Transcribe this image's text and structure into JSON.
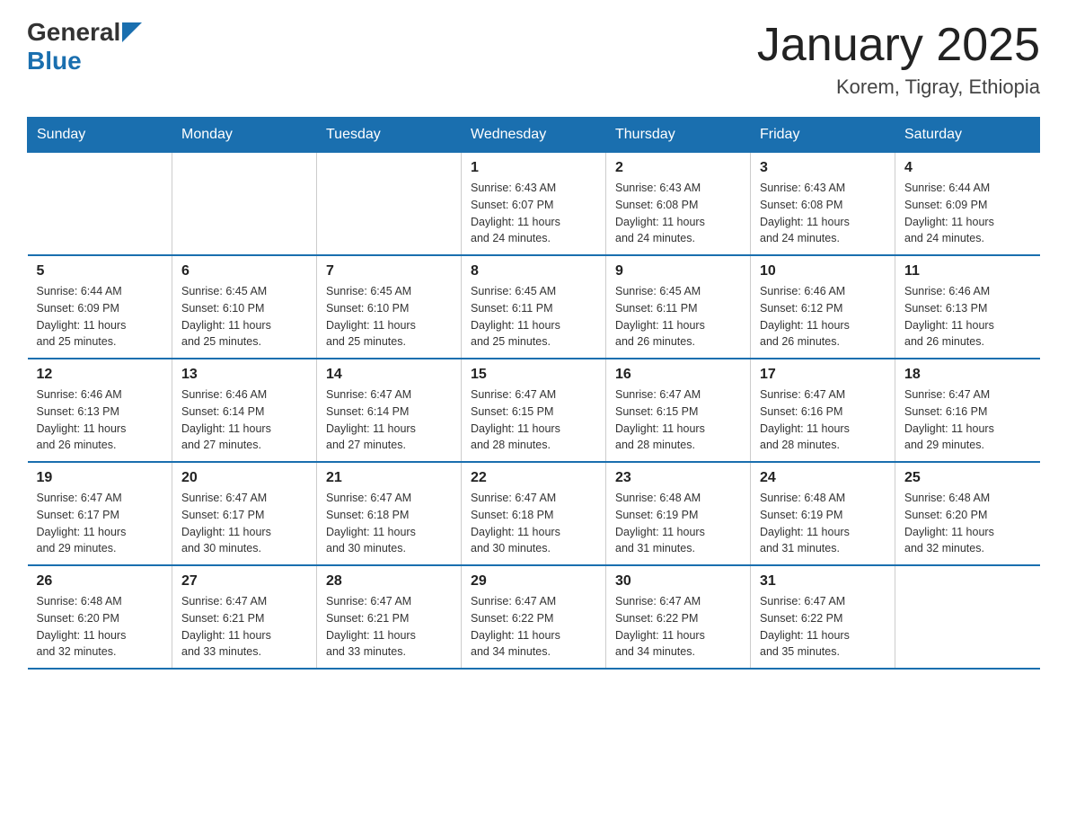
{
  "header": {
    "logo_general": "General",
    "logo_blue": "Blue",
    "title": "January 2025",
    "subtitle": "Korem, Tigray, Ethiopia"
  },
  "days_of_week": [
    "Sunday",
    "Monday",
    "Tuesday",
    "Wednesday",
    "Thursday",
    "Friday",
    "Saturday"
  ],
  "weeks": [
    [
      {
        "day": "",
        "info": ""
      },
      {
        "day": "",
        "info": ""
      },
      {
        "day": "",
        "info": ""
      },
      {
        "day": "1",
        "info": "Sunrise: 6:43 AM\nSunset: 6:07 PM\nDaylight: 11 hours\nand 24 minutes."
      },
      {
        "day": "2",
        "info": "Sunrise: 6:43 AM\nSunset: 6:08 PM\nDaylight: 11 hours\nand 24 minutes."
      },
      {
        "day": "3",
        "info": "Sunrise: 6:43 AM\nSunset: 6:08 PM\nDaylight: 11 hours\nand 24 minutes."
      },
      {
        "day": "4",
        "info": "Sunrise: 6:44 AM\nSunset: 6:09 PM\nDaylight: 11 hours\nand 24 minutes."
      }
    ],
    [
      {
        "day": "5",
        "info": "Sunrise: 6:44 AM\nSunset: 6:09 PM\nDaylight: 11 hours\nand 25 minutes."
      },
      {
        "day": "6",
        "info": "Sunrise: 6:45 AM\nSunset: 6:10 PM\nDaylight: 11 hours\nand 25 minutes."
      },
      {
        "day": "7",
        "info": "Sunrise: 6:45 AM\nSunset: 6:10 PM\nDaylight: 11 hours\nand 25 minutes."
      },
      {
        "day": "8",
        "info": "Sunrise: 6:45 AM\nSunset: 6:11 PM\nDaylight: 11 hours\nand 25 minutes."
      },
      {
        "day": "9",
        "info": "Sunrise: 6:45 AM\nSunset: 6:11 PM\nDaylight: 11 hours\nand 26 minutes."
      },
      {
        "day": "10",
        "info": "Sunrise: 6:46 AM\nSunset: 6:12 PM\nDaylight: 11 hours\nand 26 minutes."
      },
      {
        "day": "11",
        "info": "Sunrise: 6:46 AM\nSunset: 6:13 PM\nDaylight: 11 hours\nand 26 minutes."
      }
    ],
    [
      {
        "day": "12",
        "info": "Sunrise: 6:46 AM\nSunset: 6:13 PM\nDaylight: 11 hours\nand 26 minutes."
      },
      {
        "day": "13",
        "info": "Sunrise: 6:46 AM\nSunset: 6:14 PM\nDaylight: 11 hours\nand 27 minutes."
      },
      {
        "day": "14",
        "info": "Sunrise: 6:47 AM\nSunset: 6:14 PM\nDaylight: 11 hours\nand 27 minutes."
      },
      {
        "day": "15",
        "info": "Sunrise: 6:47 AM\nSunset: 6:15 PM\nDaylight: 11 hours\nand 28 minutes."
      },
      {
        "day": "16",
        "info": "Sunrise: 6:47 AM\nSunset: 6:15 PM\nDaylight: 11 hours\nand 28 minutes."
      },
      {
        "day": "17",
        "info": "Sunrise: 6:47 AM\nSunset: 6:16 PM\nDaylight: 11 hours\nand 28 minutes."
      },
      {
        "day": "18",
        "info": "Sunrise: 6:47 AM\nSunset: 6:16 PM\nDaylight: 11 hours\nand 29 minutes."
      }
    ],
    [
      {
        "day": "19",
        "info": "Sunrise: 6:47 AM\nSunset: 6:17 PM\nDaylight: 11 hours\nand 29 minutes."
      },
      {
        "day": "20",
        "info": "Sunrise: 6:47 AM\nSunset: 6:17 PM\nDaylight: 11 hours\nand 30 minutes."
      },
      {
        "day": "21",
        "info": "Sunrise: 6:47 AM\nSunset: 6:18 PM\nDaylight: 11 hours\nand 30 minutes."
      },
      {
        "day": "22",
        "info": "Sunrise: 6:47 AM\nSunset: 6:18 PM\nDaylight: 11 hours\nand 30 minutes."
      },
      {
        "day": "23",
        "info": "Sunrise: 6:48 AM\nSunset: 6:19 PM\nDaylight: 11 hours\nand 31 minutes."
      },
      {
        "day": "24",
        "info": "Sunrise: 6:48 AM\nSunset: 6:19 PM\nDaylight: 11 hours\nand 31 minutes."
      },
      {
        "day": "25",
        "info": "Sunrise: 6:48 AM\nSunset: 6:20 PM\nDaylight: 11 hours\nand 32 minutes."
      }
    ],
    [
      {
        "day": "26",
        "info": "Sunrise: 6:48 AM\nSunset: 6:20 PM\nDaylight: 11 hours\nand 32 minutes."
      },
      {
        "day": "27",
        "info": "Sunrise: 6:47 AM\nSunset: 6:21 PM\nDaylight: 11 hours\nand 33 minutes."
      },
      {
        "day": "28",
        "info": "Sunrise: 6:47 AM\nSunset: 6:21 PM\nDaylight: 11 hours\nand 33 minutes."
      },
      {
        "day": "29",
        "info": "Sunrise: 6:47 AM\nSunset: 6:22 PM\nDaylight: 11 hours\nand 34 minutes."
      },
      {
        "day": "30",
        "info": "Sunrise: 6:47 AM\nSunset: 6:22 PM\nDaylight: 11 hours\nand 34 minutes."
      },
      {
        "day": "31",
        "info": "Sunrise: 6:47 AM\nSunset: 6:22 PM\nDaylight: 11 hours\nand 35 minutes."
      },
      {
        "day": "",
        "info": ""
      }
    ]
  ]
}
